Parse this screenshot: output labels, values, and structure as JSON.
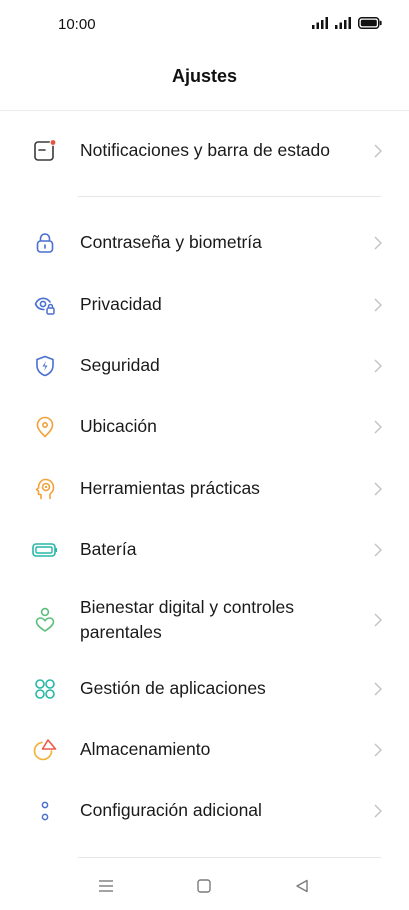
{
  "status_bar": {
    "time": "10:00",
    "icons": [
      "signal-icon",
      "signal-icon",
      "battery-icon"
    ]
  },
  "header": {
    "title": "Ajustes"
  },
  "colors": {
    "text": "#1a1a1a",
    "chevron": "#c4c4c4",
    "notification_dot": "#e5533d",
    "blue_icon": "#4a6fd1",
    "orange_icon": "#f1a23a",
    "teal_icon": "#26b7a5",
    "green_icon": "#5cbf7a",
    "storage_red": "#ea5b4a",
    "storage_yellow": "#f2b43c"
  },
  "items": [
    {
      "label": "Notificaciones y barra de estado",
      "icon": "notification-icon"
    },
    {
      "label": "Contraseña y biometría",
      "icon": "lock-icon"
    },
    {
      "label": "Privacidad",
      "icon": "privacy-eye-icon"
    },
    {
      "label": "Seguridad",
      "icon": "shield-icon"
    },
    {
      "label": "Ubicación",
      "icon": "location-pin-icon"
    },
    {
      "label": "Herramientas prácticas",
      "icon": "tools-head-icon"
    },
    {
      "label": "Batería",
      "icon": "battery-icon"
    },
    {
      "label": "Bienestar digital y controles parentales",
      "icon": "wellbeing-icon"
    },
    {
      "label": "Gestión de aplicaciones",
      "icon": "apps-grid-icon"
    },
    {
      "label": "Almacenamiento",
      "icon": "storage-pie-icon"
    },
    {
      "label": "Configuración adicional",
      "icon": "more-settings-icon"
    }
  ],
  "nav_bar": [
    "menu-icon",
    "home-icon",
    "back-icon"
  ]
}
